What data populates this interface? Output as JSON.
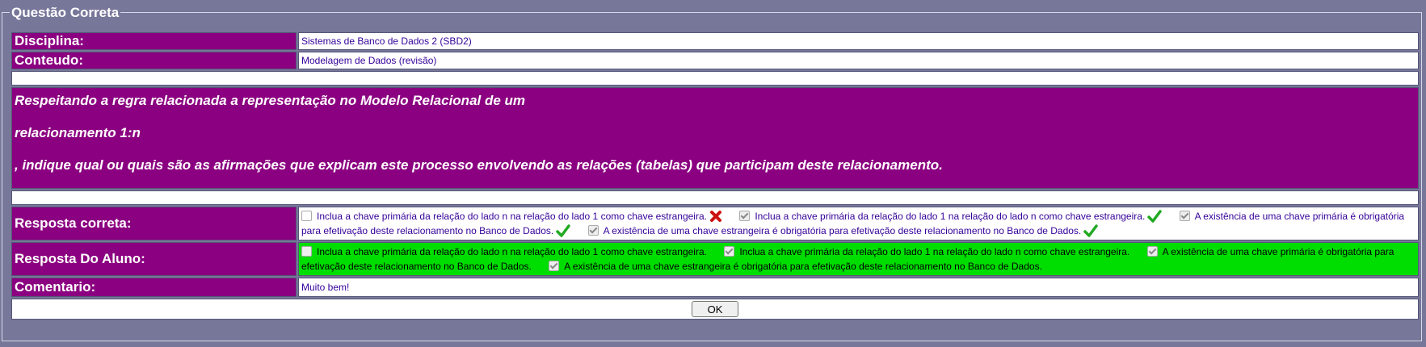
{
  "legend": "Questão Correta",
  "disciplina": {
    "label": "Disciplina:",
    "value": "Sistemas de Banco de Dados 2 (SBD2)"
  },
  "conteudo": {
    "label": "Conteudo:",
    "value": "Modelagem de Dados (revisão)"
  },
  "question": {
    "line1": "Respeitando a regra relacionada a representação no Modelo Relacional de um",
    "line2": "relacionamento 1:n",
    "line3": ", indique qual ou quais são as afirmações que explicam este processo envolvendo as relações (tabelas) que participam deste relacionamento."
  },
  "correct_answer": {
    "label": "Resposta correta:",
    "options": [
      {
        "text": "Inclua a chave primária da relação do lado n na relação do lado 1 como chave estrangeira.",
        "checked": false,
        "mark": "wrong"
      },
      {
        "text": "Inclua a chave primária da relação do lado 1 na relação do lado n como chave estrangeira.",
        "checked": true,
        "mark": "right"
      },
      {
        "text": "A existência de uma chave primária é obrigatória para efetivação deste relacionamento no Banco de Dados.",
        "checked": true,
        "mark": "right"
      },
      {
        "text": "A existência de uma chave estrangeira é obrigatória para efetivação deste relacionamento no Banco de Dados.",
        "checked": true,
        "mark": "right"
      }
    ]
  },
  "student_answer": {
    "label": "Resposta Do Aluno:",
    "background": "#00dd00",
    "options": [
      {
        "text": "Inclua a chave primária da relação do lado n na relação do lado 1 como chave estrangeira.",
        "checked": false
      },
      {
        "text": "Inclua a chave primária da relação do lado 1 na relação do lado n como chave estrangeira.",
        "checked": true
      },
      {
        "text": "A existência de uma chave primária é obrigatória para efetivação deste relacionamento no Banco de Dados.",
        "checked": true
      },
      {
        "text": "A existência de uma chave estrangeira é obrigatória para efetivação deste relacionamento no Banco de Dados.",
        "checked": true
      }
    ]
  },
  "comentario": {
    "label": "Comentario:",
    "value": "Muito bem!"
  },
  "ok_button": "OK",
  "colors": {
    "label_bg": "#8b0080",
    "page_bg": "#77779a",
    "text": "#330099"
  }
}
